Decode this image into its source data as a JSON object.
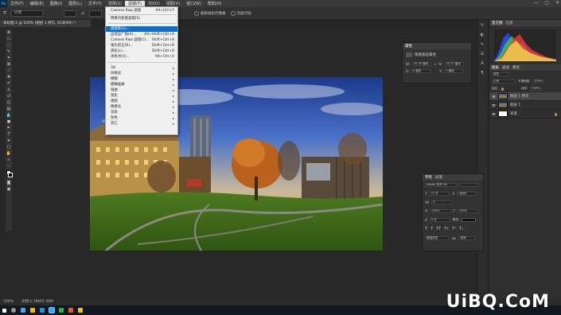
{
  "menubar": {
    "logo": "Ps",
    "items": [
      "文件(F)",
      "编辑(E)",
      "图像(I)",
      "图层(L)",
      "文字(Y)",
      "选择(S)",
      "滤镜(T)",
      "3D(D)",
      "视图(V)",
      "窗口(W)",
      "帮助(H)"
    ],
    "active_index": 6,
    "window_controls": [
      "—",
      "▢",
      "✕"
    ]
  },
  "options": {
    "mode_label": "比例",
    "field_label": "拉直",
    "checkbox1": "删除裁剪的像素",
    "checkbox2": "内容识别"
  },
  "document": {
    "tab_title": "未标题-1 @ 100% (图层 1 拷贝, RGB/8#) *"
  },
  "filter_menu": {
    "items": [
      {
        "label": "Camera Raw 滤镜",
        "shortcut": "Alt+Ctrl+F",
        "sub": false
      },
      {
        "label": "转换为智能滤镜(S)",
        "shortcut": "",
        "sub": false
      },
      {
        "label": "滤镜库(G)...",
        "shortcut": "",
        "sub": false,
        "highlight": true
      },
      {
        "label": "自适应广角(A)...",
        "shortcut": "Alt+Shift+Ctrl+A",
        "sub": false
      },
      {
        "label": "Camera Raw 滤镜(C)...",
        "shortcut": "Shift+Ctrl+A",
        "sub": false
      },
      {
        "label": "镜头校正(R)...",
        "shortcut": "Shift+Ctrl+R",
        "sub": false
      },
      {
        "label": "液化(L)...",
        "shortcut": "Shift+Ctrl+X",
        "sub": false
      },
      {
        "label": "消失点(V)...",
        "shortcut": "Alt+Ctrl+V",
        "sub": false
      },
      {
        "label": "3D",
        "shortcut": "",
        "sub": true
      },
      {
        "label": "风格化",
        "shortcut": "",
        "sub": true
      },
      {
        "label": "模糊",
        "shortcut": "",
        "sub": true
      },
      {
        "label": "模糊画廊",
        "shortcut": "",
        "sub": true
      },
      {
        "label": "扭曲",
        "shortcut": "",
        "sub": true
      },
      {
        "label": "锐化",
        "shortcut": "",
        "sub": true
      },
      {
        "label": "视频",
        "shortcut": "",
        "sub": true
      },
      {
        "label": "像素化",
        "shortcut": "",
        "sub": true
      },
      {
        "label": "渲染",
        "shortcut": "",
        "sub": true
      },
      {
        "label": "杂色",
        "shortcut": "",
        "sub": true
      },
      {
        "label": "其它",
        "shortcut": "",
        "sub": true
      }
    ]
  },
  "properties": {
    "title": "属性",
    "subtitle": "像素图层属性",
    "w_label": "W:",
    "w_value": "35.28 厘米",
    "h_label": "H:",
    "h_value": "20.32 厘米",
    "x_label": "X:",
    "x_value": "0 厘米",
    "y_label": "Y:",
    "y_value": "0 厘米"
  },
  "panels": {
    "histogram_tabs": [
      "直方图",
      "信息"
    ],
    "layers_tabs": [
      "图层",
      "通道",
      "路径"
    ],
    "kind_label": "类型",
    "blend_mode": "正常",
    "opacity_label": "不透明度:",
    "opacity_value": "100%",
    "lock_label": "锁定:",
    "fill_label": "填充:",
    "fill_value": "100%",
    "layers": [
      {
        "name": "图层 1 拷贝",
        "selected": true
      },
      {
        "name": "图层 1",
        "selected": false
      },
      {
        "name": "背景",
        "selected": false
      }
    ]
  },
  "character": {
    "tabs": [
      "字符",
      "段落"
    ],
    "font_family": "Adobe 宋体 Std",
    "font_style": "-",
    "size": "72 点",
    "leading": "(自动)",
    "tracking": "0",
    "scale_v": "100%",
    "scale_h": "100%",
    "baseline": "0 点",
    "color_label": "颜色:",
    "language": "美国英语",
    "antialias": "锐利"
  },
  "status": {
    "zoom": "100%",
    "doc_info": "文档:1.78M/5.36M"
  },
  "watermark": "UiBQ.CoM"
}
